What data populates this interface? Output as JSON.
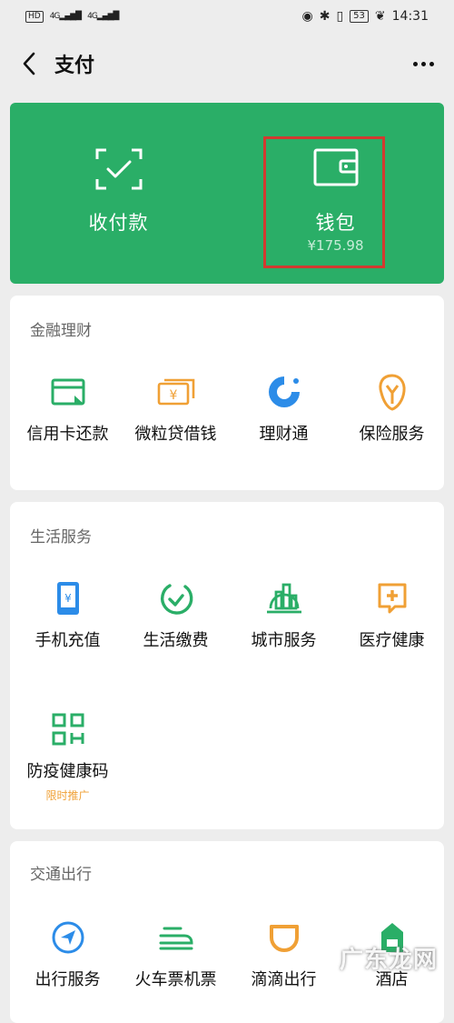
{
  "status_bar": {
    "network_badge": "HD",
    "signal_1": "4G",
    "signal_2": "4G",
    "battery": "53",
    "time": "14:31"
  },
  "header": {
    "title": "支付"
  },
  "top_panel": {
    "receive_label": "收付款",
    "wallet_label": "钱包",
    "wallet_balance": "¥175.98",
    "bg_color": "#2aae67",
    "highlight_color": "#d23a30"
  },
  "finance": {
    "title": "金融理财",
    "items": [
      {
        "label": "信用卡还款",
        "icon": "credit-card-icon",
        "color": "#2aae67"
      },
      {
        "label": "微粒贷借钱",
        "icon": "yen-bill-icon",
        "color": "#f0a035"
      },
      {
        "label": "理财通",
        "icon": "wealth-icon",
        "color": "#2c8ce8"
      },
      {
        "label": "保险服务",
        "icon": "insurance-icon",
        "color": "#f0a035"
      }
    ]
  },
  "life": {
    "title": "生活服务",
    "items": [
      {
        "label": "手机充值",
        "icon": "phone-topup-icon",
        "color": "#2c8ce8"
      },
      {
        "label": "生活缴费",
        "icon": "utility-bill-icon",
        "color": "#2aae67"
      },
      {
        "label": "城市服务",
        "icon": "city-buildings-icon",
        "color": "#2aae67"
      },
      {
        "label": "医疗健康",
        "icon": "medical-icon",
        "color": "#f0a035"
      },
      {
        "label": "防疫健康码",
        "sub": "限时推广",
        "icon": "qr-code-icon",
        "color": "#2aae67"
      }
    ]
  },
  "transport": {
    "title": "交通出行",
    "items": [
      {
        "label": "出行服务",
        "icon": "navigation-icon",
        "color": "#2c8ce8"
      },
      {
        "label": "火车票机票",
        "icon": "train-icon",
        "color": "#2aae67"
      },
      {
        "label": "滴滴出行",
        "icon": "didi-icon",
        "color": "#f0a035"
      },
      {
        "label": "酒店",
        "icon": "hotel-icon",
        "color": "#2aae67"
      }
    ]
  },
  "watermark": "广东龙网"
}
